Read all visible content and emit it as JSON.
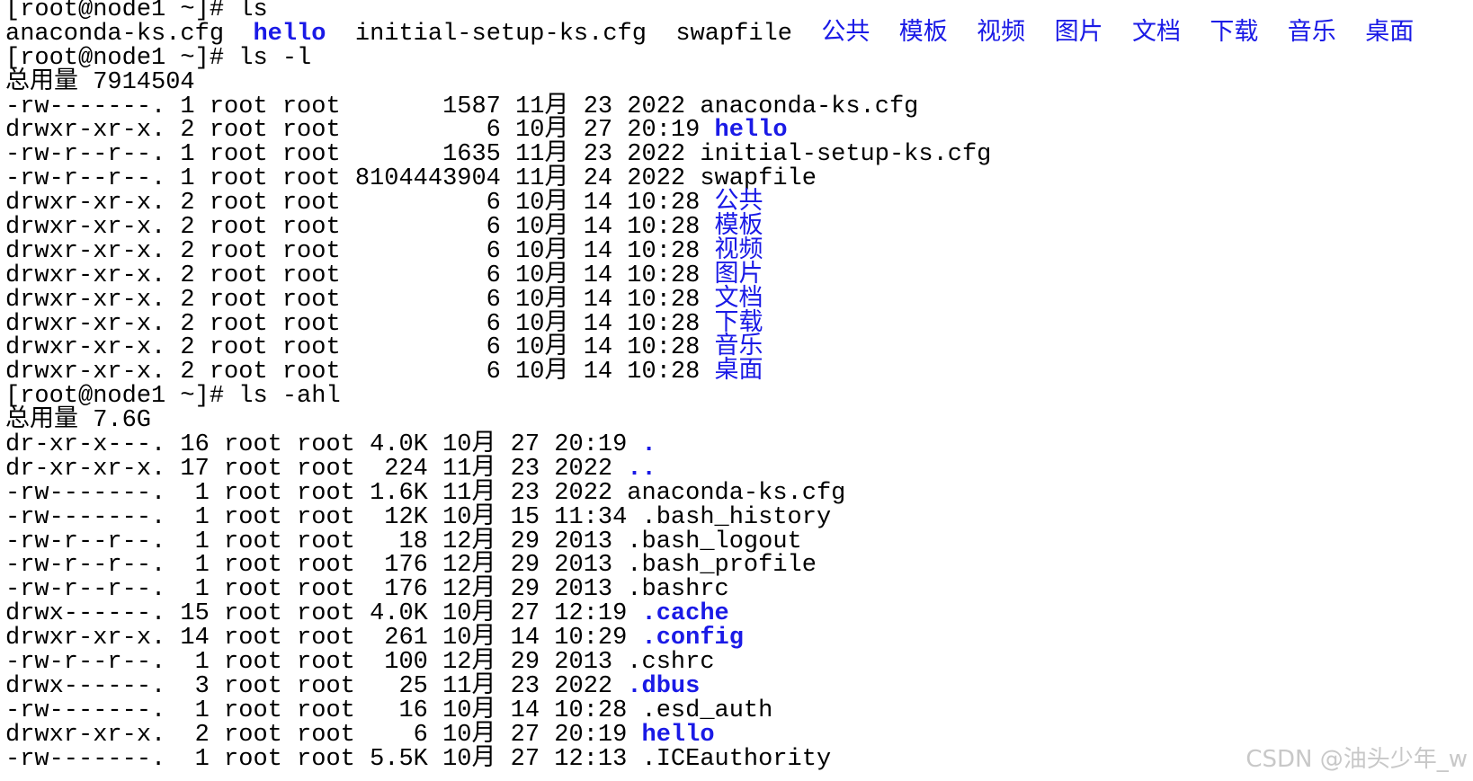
{
  "terminal": {
    "lines": [
      [
        {
          "t": "[root@node1 ~]# ls"
        }
      ],
      [
        {
          "t": "anaconda-ks.cfg  "
        },
        {
          "t": "hello",
          "c": "dir"
        },
        {
          "t": "  initial-setup-ks.cfg  swapfile  "
        },
        {
          "t": "公共",
          "c": "cjk-dir"
        },
        {
          "t": "  "
        },
        {
          "t": "模板",
          "c": "cjk-dir"
        },
        {
          "t": "  "
        },
        {
          "t": "视频",
          "c": "cjk-dir"
        },
        {
          "t": "  "
        },
        {
          "t": "图片",
          "c": "cjk-dir"
        },
        {
          "t": "  "
        },
        {
          "t": "文档",
          "c": "cjk-dir"
        },
        {
          "t": "  "
        },
        {
          "t": "下载",
          "c": "cjk-dir"
        },
        {
          "t": "  "
        },
        {
          "t": "音乐",
          "c": "cjk-dir"
        },
        {
          "t": "  "
        },
        {
          "t": "桌面",
          "c": "cjk-dir"
        }
      ],
      [
        {
          "t": "[root@node1 ~]# ls -l"
        }
      ],
      [
        {
          "t": "总用量 7914504"
        }
      ],
      [
        {
          "t": "-rw-------. 1 root root       1587 11月 23 2022 anaconda-ks.cfg"
        }
      ],
      [
        {
          "t": "drwxr-xr-x. 2 root root          6 10月 27 20:19 "
        },
        {
          "t": "hello",
          "c": "dir"
        }
      ],
      [
        {
          "t": "-rw-r--r--. 1 root root       1635 11月 23 2022 initial-setup-ks.cfg"
        }
      ],
      [
        {
          "t": "-rw-r--r--. 1 root root 8104443904 11月 24 2022 swapfile"
        }
      ],
      [
        {
          "t": "drwxr-xr-x. 2 root root          6 10月 14 10:28 "
        },
        {
          "t": "公共",
          "c": "cjk-dir"
        }
      ],
      [
        {
          "t": "drwxr-xr-x. 2 root root          6 10月 14 10:28 "
        },
        {
          "t": "模板",
          "c": "cjk-dir"
        }
      ],
      [
        {
          "t": "drwxr-xr-x. 2 root root          6 10月 14 10:28 "
        },
        {
          "t": "视频",
          "c": "cjk-dir"
        }
      ],
      [
        {
          "t": "drwxr-xr-x. 2 root root          6 10月 14 10:28 "
        },
        {
          "t": "图片",
          "c": "cjk-dir"
        }
      ],
      [
        {
          "t": "drwxr-xr-x. 2 root root          6 10月 14 10:28 "
        },
        {
          "t": "文档",
          "c": "cjk-dir"
        }
      ],
      [
        {
          "t": "drwxr-xr-x. 2 root root          6 10月 14 10:28 "
        },
        {
          "t": "下载",
          "c": "cjk-dir"
        }
      ],
      [
        {
          "t": "drwxr-xr-x. 2 root root          6 10月 14 10:28 "
        },
        {
          "t": "音乐",
          "c": "cjk-dir"
        }
      ],
      [
        {
          "t": "drwxr-xr-x. 2 root root          6 10月 14 10:28 "
        },
        {
          "t": "桌面",
          "c": "cjk-dir"
        }
      ],
      [
        {
          "t": "[root@node1 ~]# ls -ahl"
        }
      ],
      [
        {
          "t": "总用量 7.6G"
        }
      ],
      [
        {
          "t": "dr-xr-x---. 16 root root 4.0K 10月 27 20:19 "
        },
        {
          "t": ".",
          "c": "dir"
        }
      ],
      [
        {
          "t": "dr-xr-xr-x. 17 root root  224 11月 23 2022 "
        },
        {
          "t": "..",
          "c": "dir"
        }
      ],
      [
        {
          "t": "-rw-------.  1 root root 1.6K 11月 23 2022 anaconda-ks.cfg"
        }
      ],
      [
        {
          "t": "-rw-------.  1 root root  12K 10月 15 11:34 .bash_history"
        }
      ],
      [
        {
          "t": "-rw-r--r--.  1 root root   18 12月 29 2013 .bash_logout"
        }
      ],
      [
        {
          "t": "-rw-r--r--.  1 root root  176 12月 29 2013 .bash_profile"
        }
      ],
      [
        {
          "t": "-rw-r--r--.  1 root root  176 12月 29 2013 .bashrc"
        }
      ],
      [
        {
          "t": "drwx------. 15 root root 4.0K 10月 27 12:19 "
        },
        {
          "t": ".cache",
          "c": "dir"
        }
      ],
      [
        {
          "t": "drwxr-xr-x. 14 root root  261 10月 14 10:29 "
        },
        {
          "t": ".config",
          "c": "dir"
        }
      ],
      [
        {
          "t": "-rw-r--r--.  1 root root  100 12月 29 2013 .cshrc"
        }
      ],
      [
        {
          "t": "drwx------.  3 root root   25 11月 23 2022 "
        },
        {
          "t": ".dbus",
          "c": "dir"
        }
      ],
      [
        {
          "t": "-rw-------.  1 root root   16 10月 14 10:28 .esd_auth"
        }
      ],
      [
        {
          "t": "drwxr-xr-x.  2 root root    6 10月 27 20:19 "
        },
        {
          "t": "hello",
          "c": "dir"
        }
      ],
      [
        {
          "t": "-rw-------.  1 root root 5.5K 10月 27 12:13 .ICEauthority"
        }
      ]
    ]
  },
  "watermark": "CSDN @油头少年_w",
  "colors": {
    "background": "#ffffff",
    "text": "#000000",
    "directory": "#1a1ae6",
    "watermark": "#c8c8c8"
  }
}
